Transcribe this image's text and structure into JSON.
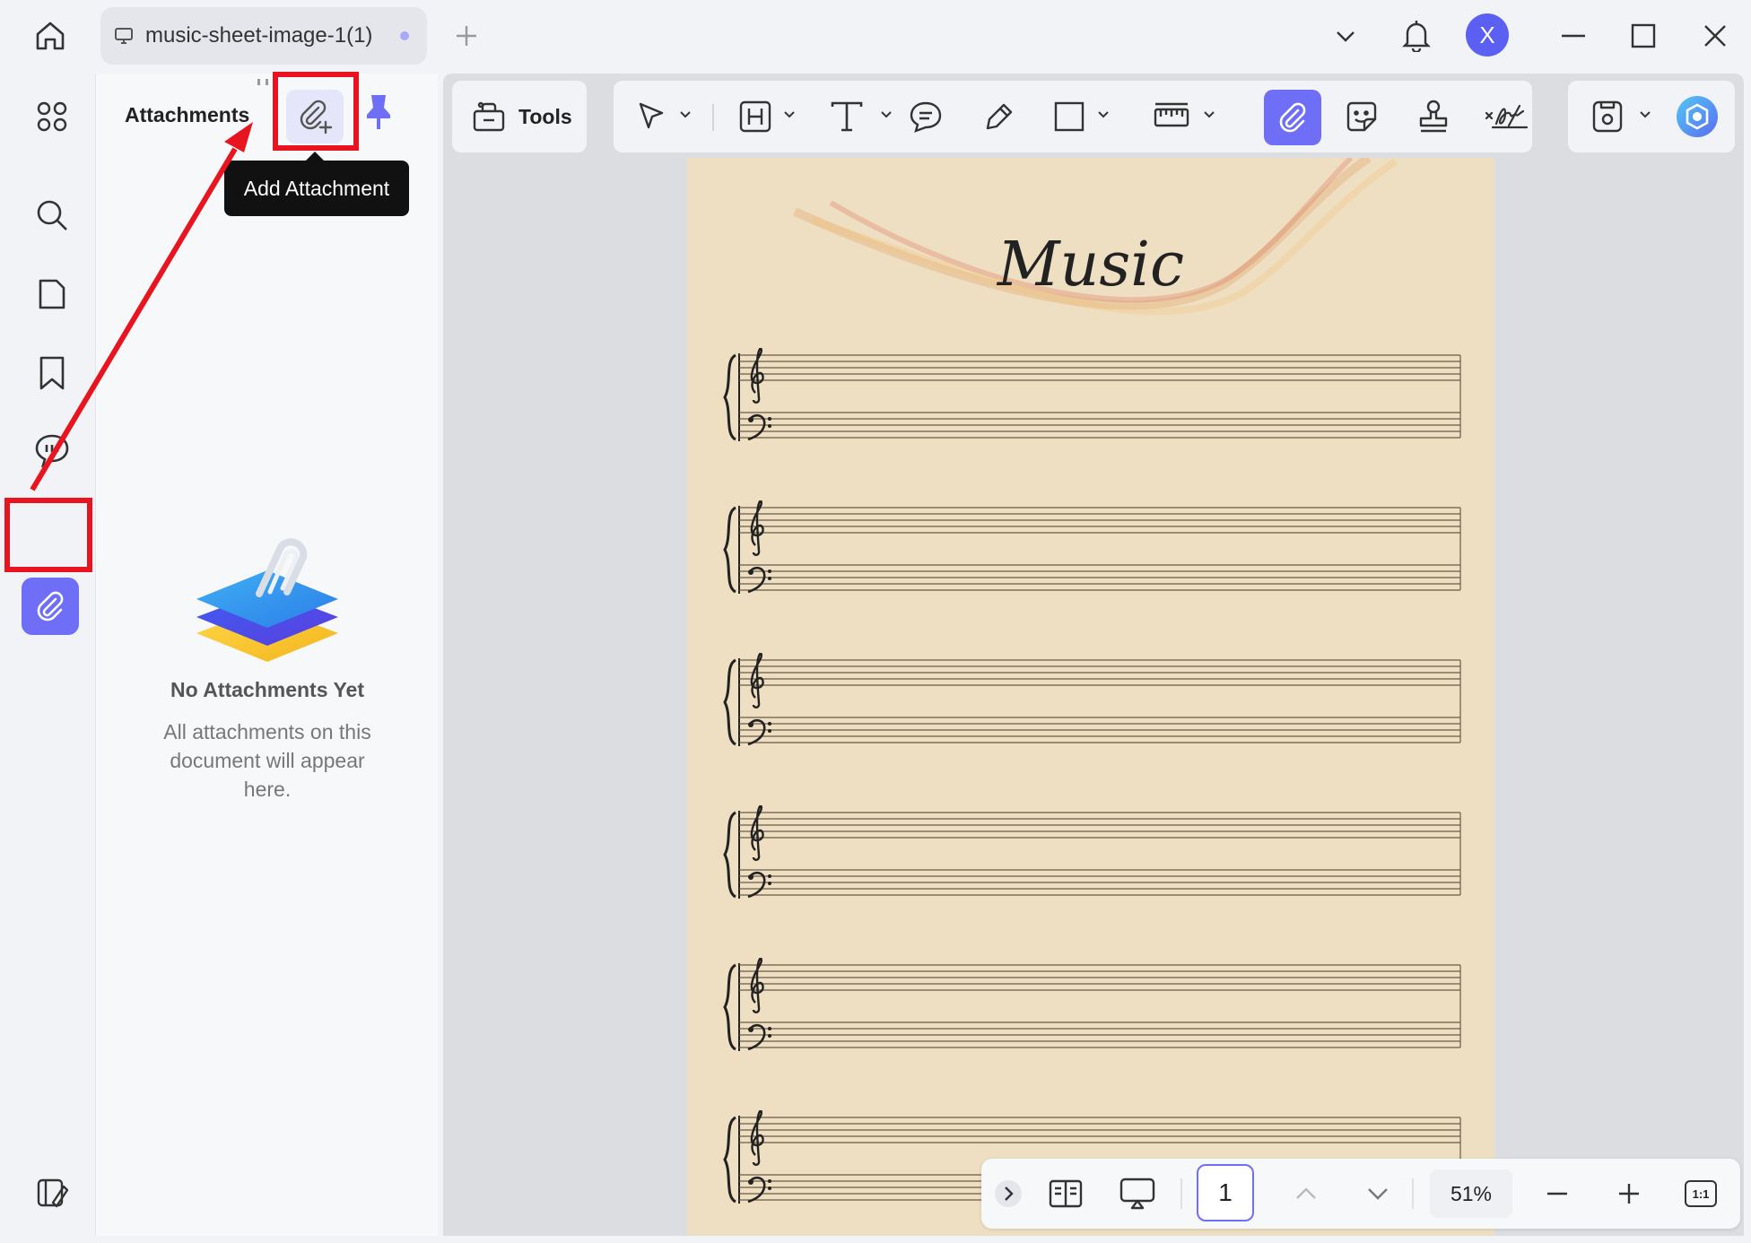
{
  "titlebar": {
    "tab_title": "music-sheet-image-1(1)",
    "avatar_letter": "X"
  },
  "panel": {
    "title": "Attachments",
    "tooltip": "Add Attachment",
    "empty_title": "No Attachments Yet",
    "empty_description": "All attachments on this document will appear here."
  },
  "toolbar": {
    "tools_label": "Tools",
    "annotation_tools": [
      "select-tool",
      "highlight-tool",
      "text-tool",
      "comment-tool",
      "pencil-tool",
      "shape-tool",
      "measure-tool",
      "attachment-tool",
      "sticker-tool",
      "stamp-tool",
      "signature-tool"
    ],
    "active_tool": "attachment-tool"
  },
  "document": {
    "title": "Music",
    "staff_count": 6
  },
  "bottombar": {
    "page_number": "1",
    "zoom": "51%",
    "fit_label": "1:1"
  },
  "colors": {
    "accent": "#6e6ef7",
    "annotation_red": "#e8141f",
    "paper": "#efdfc2"
  }
}
